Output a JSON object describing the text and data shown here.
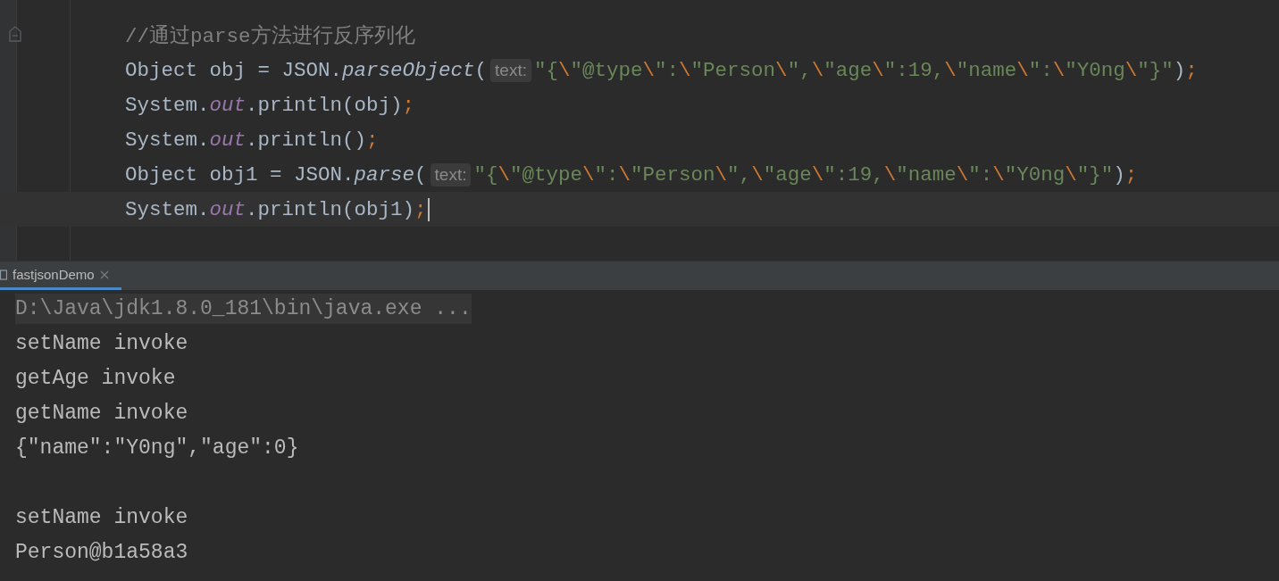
{
  "editor": {
    "lines": [
      {
        "current": false,
        "tokens": [
          {
            "kind": "comment",
            "text": "//通过parse方法进行反序列化"
          }
        ]
      },
      {
        "current": false,
        "tokens": [
          {
            "kind": "plain",
            "text": "Object obj = JSON."
          },
          {
            "kind": "method",
            "text": "parseObject"
          },
          {
            "kind": "plain",
            "text": "("
          },
          {
            "kind": "hint",
            "text": "text:"
          },
          {
            "kind": "string",
            "text": "\"{"
          },
          {
            "kind": "escape",
            "text": "\\"
          },
          {
            "kind": "string",
            "text": "\"@type"
          },
          {
            "kind": "escape",
            "text": "\\"
          },
          {
            "kind": "string",
            "text": "\":"
          },
          {
            "kind": "escape",
            "text": "\\"
          },
          {
            "kind": "string",
            "text": "\"Person"
          },
          {
            "kind": "escape",
            "text": "\\"
          },
          {
            "kind": "string",
            "text": "\","
          },
          {
            "kind": "escape",
            "text": "\\"
          },
          {
            "kind": "string",
            "text": "\"age"
          },
          {
            "kind": "escape",
            "text": "\\"
          },
          {
            "kind": "string",
            "text": "\":19,"
          },
          {
            "kind": "escape",
            "text": "\\"
          },
          {
            "kind": "string",
            "text": "\"name"
          },
          {
            "kind": "escape",
            "text": "\\"
          },
          {
            "kind": "string",
            "text": "\":"
          },
          {
            "kind": "escape",
            "text": "\\"
          },
          {
            "kind": "string",
            "text": "\"Y0ng"
          },
          {
            "kind": "escape",
            "text": "\\"
          },
          {
            "kind": "string",
            "text": "\"}\""
          },
          {
            "kind": "plain",
            "text": ")"
          },
          {
            "kind": "punct",
            "text": ";"
          }
        ]
      },
      {
        "current": false,
        "tokens": [
          {
            "kind": "plain",
            "text": "System."
          },
          {
            "kind": "static",
            "text": "out"
          },
          {
            "kind": "plain",
            "text": ".println(obj)"
          },
          {
            "kind": "punct",
            "text": ";"
          }
        ]
      },
      {
        "current": false,
        "tokens": [
          {
            "kind": "plain",
            "text": "System."
          },
          {
            "kind": "static",
            "text": "out"
          },
          {
            "kind": "plain",
            "text": ".println()"
          },
          {
            "kind": "punct",
            "text": ";"
          }
        ]
      },
      {
        "current": false,
        "tokens": [
          {
            "kind": "plain",
            "text": "Object obj1 = JSON."
          },
          {
            "kind": "method",
            "text": "parse"
          },
          {
            "kind": "plain",
            "text": "("
          },
          {
            "kind": "hint",
            "text": "text:"
          },
          {
            "kind": "string",
            "text": "\"{"
          },
          {
            "kind": "escape",
            "text": "\\"
          },
          {
            "kind": "string",
            "text": "\"@type"
          },
          {
            "kind": "escape",
            "text": "\\"
          },
          {
            "kind": "string",
            "text": "\":"
          },
          {
            "kind": "escape",
            "text": "\\"
          },
          {
            "kind": "string",
            "text": "\"Person"
          },
          {
            "kind": "escape",
            "text": "\\"
          },
          {
            "kind": "string",
            "text": "\","
          },
          {
            "kind": "escape",
            "text": "\\"
          },
          {
            "kind": "string",
            "text": "\"age"
          },
          {
            "kind": "escape",
            "text": "\\"
          },
          {
            "kind": "string",
            "text": "\":19,"
          },
          {
            "kind": "escape",
            "text": "\\"
          },
          {
            "kind": "string",
            "text": "\"name"
          },
          {
            "kind": "escape",
            "text": "\\"
          },
          {
            "kind": "string",
            "text": "\":"
          },
          {
            "kind": "escape",
            "text": "\\"
          },
          {
            "kind": "string",
            "text": "\"Y0ng"
          },
          {
            "kind": "escape",
            "text": "\\"
          },
          {
            "kind": "string",
            "text": "\"}\""
          },
          {
            "kind": "plain",
            "text": ")"
          },
          {
            "kind": "punct",
            "text": ";"
          }
        ]
      },
      {
        "current": true,
        "tokens": [
          {
            "kind": "plain",
            "text": "System."
          },
          {
            "kind": "static",
            "text": "out"
          },
          {
            "kind": "plain",
            "text": ".println(obj1)"
          },
          {
            "kind": "punct",
            "text": ";"
          }
        ]
      }
    ]
  },
  "run_panel": {
    "tabs": [
      {
        "label": "fastjsonDemo",
        "selected": true
      }
    ],
    "output": [
      {
        "kind": "command",
        "text": "D:\\Java\\jdk1.8.0_181\\bin\\java.exe ..."
      },
      {
        "kind": "plain",
        "text": "setName invoke"
      },
      {
        "kind": "plain",
        "text": "getAge invoke"
      },
      {
        "kind": "plain",
        "text": "getName invoke"
      },
      {
        "kind": "plain",
        "text": "{\"name\":\"Y0ng\",\"age\":0}"
      },
      {
        "kind": "blank"
      },
      {
        "kind": "plain",
        "text": "setName invoke"
      },
      {
        "kind": "plain",
        "text": "Person@b1a58a3"
      }
    ]
  }
}
